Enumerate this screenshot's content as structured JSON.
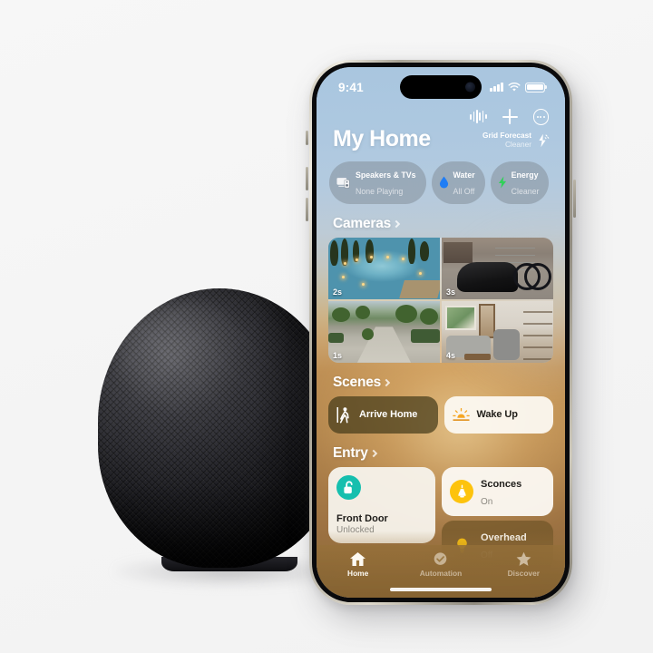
{
  "scene": {
    "background_color": "#f5f5f5",
    "devices": [
      "homepod-mini-midnight",
      "iphone-15-pro-natural-titanium"
    ]
  },
  "status_bar": {
    "time": "9:41",
    "cellular_icon": "signal-bars-icon",
    "wifi_icon": "wifi-icon",
    "battery_icon": "battery-icon"
  },
  "top_actions": [
    {
      "name": "siri-waveform-icon",
      "label": "Siri"
    },
    {
      "name": "add-icon",
      "label": "Add"
    },
    {
      "name": "more-icon",
      "label": "More"
    }
  ],
  "header": {
    "title": "My Home",
    "grid_forecast": {
      "title": "Grid Forecast",
      "subtitle": "Cleaner",
      "icon": "clean-energy-bolt-icon"
    }
  },
  "status_pills": [
    {
      "icon": "speaker-tv-icon",
      "title": "Speakers & TVs",
      "subtitle": "None Playing"
    },
    {
      "icon": "water-drop-icon",
      "title": "Water",
      "subtitle": "All Off",
      "color": "#1f7df5"
    },
    {
      "icon": "energy-bolt-icon",
      "title": "Energy",
      "subtitle": "Cleaner",
      "color": "#30d158"
    }
  ],
  "sections": {
    "cameras": {
      "title": "Cameras",
      "tiles": [
        {
          "name": "camera-pool",
          "badge": "2s",
          "scene": "backyard pool at dusk"
        },
        {
          "name": "camera-garage",
          "badge": "3s",
          "scene": "garage with covered car and bicycle"
        },
        {
          "name": "camera-driveway",
          "badge": "1s",
          "scene": "front driveway"
        },
        {
          "name": "camera-living-room",
          "badge": "4s",
          "scene": "living room"
        }
      ]
    },
    "scenes": {
      "title": "Scenes",
      "tiles": [
        {
          "name": "scene-arrive-home",
          "label": "Arrive Home",
          "icon": "walking-person-icon",
          "state": "inactive"
        },
        {
          "name": "scene-wake-up",
          "label": "Wake Up",
          "icon": "sunrise-icon",
          "state": "active"
        }
      ]
    },
    "entry": {
      "title": "Entry",
      "front_door": {
        "name": "Front Door",
        "state": "Unlocked",
        "icon": "unlock-icon",
        "accent": "#16bfae"
      },
      "lights": [
        {
          "name": "Sconces",
          "state": "On",
          "icon": "sconce-lamp-icon",
          "accent": "#fdc30d",
          "on": true
        },
        {
          "name": "Overhead",
          "state": "Off",
          "icon": "bulb-icon",
          "accent": "#fdc30d",
          "on": false
        }
      ]
    }
  },
  "tab_bar": [
    {
      "name": "tab-home",
      "label": "Home",
      "icon": "house-icon",
      "active": true
    },
    {
      "name": "tab-automation",
      "label": "Automation",
      "icon": "clock-check-icon",
      "active": false
    },
    {
      "name": "tab-discover",
      "label": "Discover",
      "icon": "star-icon",
      "active": false
    }
  ]
}
